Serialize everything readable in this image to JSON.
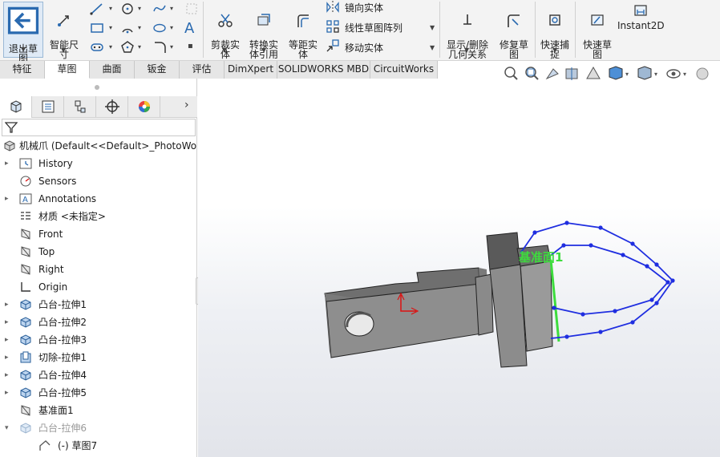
{
  "ribbon": {
    "exit_sketch": "退出草\n图",
    "smart_dim": "智能尺\n寸",
    "trim": "剪裁实\n体",
    "convert": "转换实\n体引用",
    "offset": "等距实\n体",
    "mirror": "镜向实体",
    "linear_pattern": "线性草图阵列",
    "move": "移动实体",
    "show_relations": "显示/删除\n几何关系",
    "repair": "修复草\n图",
    "quick_snap": "快速捕\n捉",
    "rapid_sketch": "快速草\n图",
    "instant2d": "Instant2D"
  },
  "tabs": [
    {
      "label": "特征",
      "active": false
    },
    {
      "label": "草图",
      "active": true
    },
    {
      "label": "曲面",
      "active": false
    },
    {
      "label": "钣金",
      "active": false
    },
    {
      "label": "评估",
      "active": false
    },
    {
      "label": "DimXpert",
      "active": false
    },
    {
      "label": "SOLIDWORKS MBD",
      "active": false
    },
    {
      "label": "CircuitWorks",
      "active": false
    }
  ],
  "tree": {
    "root": "机械爪  (Default<<Default>_PhotoWor",
    "items": [
      {
        "label": "History",
        "icon": "history-icon",
        "expand": "▸",
        "dim": false
      },
      {
        "label": "Sensors",
        "icon": "sensor-icon",
        "expand": "",
        "dim": false
      },
      {
        "label": "Annotations",
        "icon": "annotation-icon",
        "expand": "▸",
        "dim": false
      },
      {
        "label": "材质 <未指定>",
        "icon": "material-icon",
        "expand": "",
        "dim": false
      },
      {
        "label": "Front",
        "icon": "plane-icon",
        "expand": "",
        "dim": false
      },
      {
        "label": "Top",
        "icon": "plane-icon",
        "expand": "",
        "dim": false
      },
      {
        "label": "Right",
        "icon": "plane-icon",
        "expand": "",
        "dim": false
      },
      {
        "label": "Origin",
        "icon": "origin-icon",
        "expand": "",
        "dim": false
      },
      {
        "label": "凸台-拉伸1",
        "icon": "extrude-icon",
        "expand": "▸",
        "dim": false
      },
      {
        "label": "凸台-拉伸2",
        "icon": "extrude-icon",
        "expand": "▸",
        "dim": false
      },
      {
        "label": "凸台-拉伸3",
        "icon": "extrude-icon",
        "expand": "▸",
        "dim": false
      },
      {
        "label": "切除-拉伸1",
        "icon": "cut-icon",
        "expand": "▸",
        "dim": false
      },
      {
        "label": "凸台-拉伸4",
        "icon": "extrude-icon",
        "expand": "▸",
        "dim": false
      },
      {
        "label": "凸台-拉伸5",
        "icon": "extrude-icon",
        "expand": "▸",
        "dim": false
      },
      {
        "label": "基准面1",
        "icon": "plane-icon",
        "expand": "",
        "dim": false
      },
      {
        "label": "凸台-拉伸6",
        "icon": "extrude-icon",
        "expand": "▾",
        "dim": true
      },
      {
        "label": "(-) 草图7",
        "icon": "sketch-icon",
        "expand": "",
        "dim": false
      }
    ]
  },
  "viewport": {
    "plane_label": "基准面1",
    "colors": {
      "sketch": "#1f2ee0",
      "plane_label": "#3ddc3d",
      "part": "#8c8c8c"
    }
  }
}
